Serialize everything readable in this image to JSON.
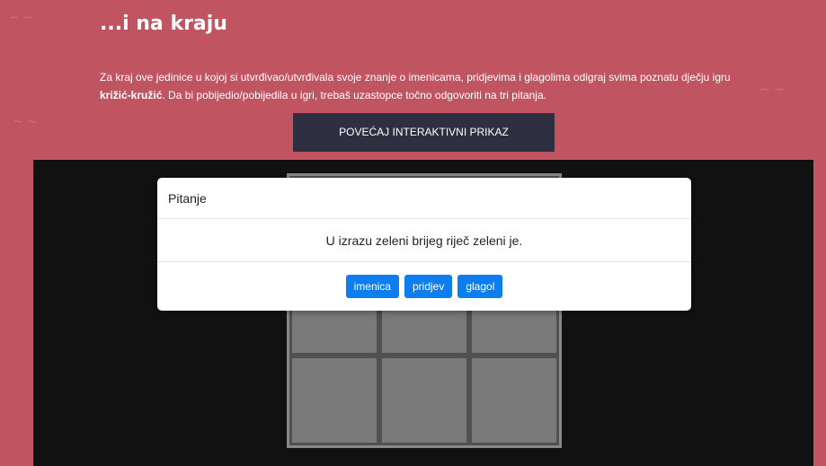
{
  "header": {
    "title": "...i na kraju",
    "intro_part1": "Za kraj ove jedinice u kojoj si utvrđivao/utvrđivala svoje znanje o imenicama, pridjevima i glagolima odigraj svima poznatu dječju igru ",
    "intro_bold": "križić-kružić",
    "intro_part2": ". Da bi pobijedio/pobijedila u igri, trebaš uzastopce točno odgovoriti na tri pitanja."
  },
  "enlarge_button": "POVEĆAJ INTERAKTIVNI PRIKAZ",
  "modal": {
    "title": "Pitanje",
    "question": "U izrazu zeleni brijeg riječ zeleni je.",
    "answers": [
      "imenica",
      "pridjev",
      "glagol"
    ]
  },
  "board": {
    "cells": [
      "",
      "",
      "",
      "",
      "",
      "",
      "",
      "",
      ""
    ]
  },
  "colors": {
    "background": "#c05561",
    "button_dark": "#2f2f42",
    "answer_blue": "#0d7ef0",
    "stage": "#111111"
  }
}
